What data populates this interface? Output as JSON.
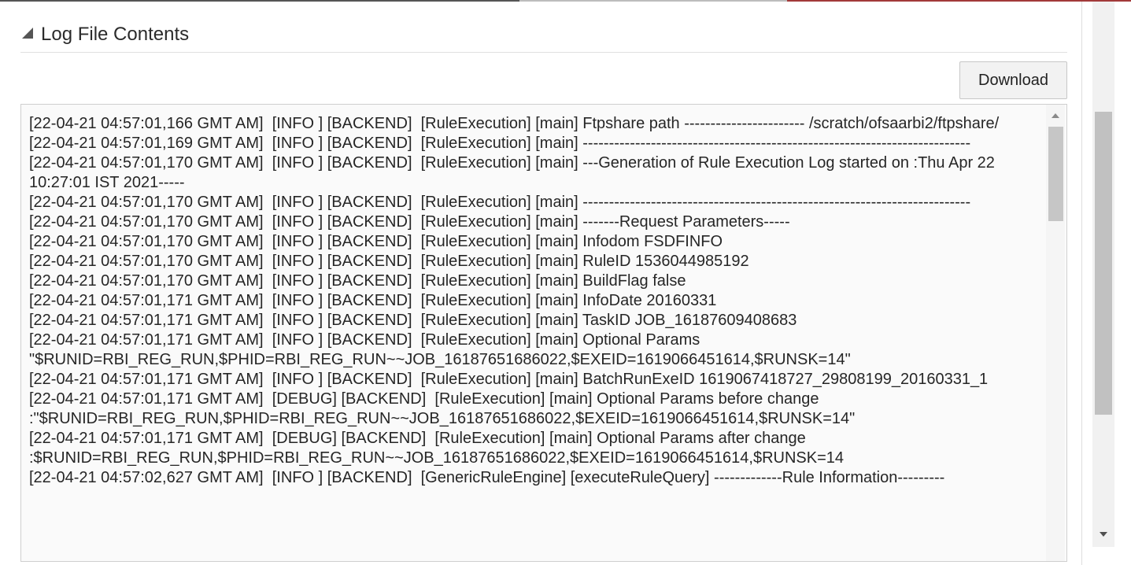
{
  "section": {
    "title": "Log File Contents",
    "collapse_icon": "triangle-collapse-icon"
  },
  "toolbar": {
    "download_label": "Download"
  },
  "log": {
    "lines": [
      "[22-04-21 04:57:01,166 GMT AM]  [INFO ] [BACKEND]  [RuleExecution] [main] Ftpshare path ----------------------- /scratch/ofsaarbi2/ftpshare/",
      "[22-04-21 04:57:01,169 GMT AM]  [INFO ] [BACKEND]  [RuleExecution] [main] --------------------------------------------------------------------------",
      "[22-04-21 04:57:01,170 GMT AM]  [INFO ] [BACKEND]  [RuleExecution] [main] ---Generation of Rule Execution Log started on :Thu Apr 22 10:27:01 IST 2021-----",
      "[22-04-21 04:57:01,170 GMT AM]  [INFO ] [BACKEND]  [RuleExecution] [main] --------------------------------------------------------------------------",
      "[22-04-21 04:57:01,170 GMT AM]  [INFO ] [BACKEND]  [RuleExecution] [main] -------Request Parameters-----",
      "[22-04-21 04:57:01,170 GMT AM]  [INFO ] [BACKEND]  [RuleExecution] [main] Infodom FSDFINFO",
      "[22-04-21 04:57:01,170 GMT AM]  [INFO ] [BACKEND]  [RuleExecution] [main] RuleID 1536044985192",
      "[22-04-21 04:57:01,170 GMT AM]  [INFO ] [BACKEND]  [RuleExecution] [main] BuildFlag false",
      "[22-04-21 04:57:01,171 GMT AM]  [INFO ] [BACKEND]  [RuleExecution] [main] InfoDate 20160331",
      "[22-04-21 04:57:01,171 GMT AM]  [INFO ] [BACKEND]  [RuleExecution] [main] TaskID JOB_16187609408683",
      "[22-04-21 04:57:01,171 GMT AM]  [INFO ] [BACKEND]  [RuleExecution] [main] Optional Params \"$RUNID=RBI_REG_RUN,$PHID=RBI_REG_RUN~~JOB_16187651686022,$EXEID=1619066451614,$RUNSK=14\"",
      "[22-04-21 04:57:01,171 GMT AM]  [INFO ] [BACKEND]  [RuleExecution] [main] BatchRunExeID 1619067418727_29808199_20160331_1",
      "[22-04-21 04:57:01,171 GMT AM]  [DEBUG] [BACKEND]  [RuleExecution] [main] Optional Params before change :\"$RUNID=RBI_REG_RUN,$PHID=RBI_REG_RUN~~JOB_16187651686022,$EXEID=1619066451614,$RUNSK=14\"",
      "[22-04-21 04:57:01,171 GMT AM]  [DEBUG] [BACKEND]  [RuleExecution] [main] Optional Params after change :$RUNID=RBI_REG_RUN,$PHID=RBI_REG_RUN~~JOB_16187651686022,$EXEID=1619066451614,$RUNSK=14",
      "[22-04-21 04:57:02,627 GMT AM]  [INFO ] [BACKEND]  [GenericRuleEngine] [executeRuleQuery] -------------Rule Information---------"
    ]
  },
  "scrollbars": {
    "inner_up_icon": "arrow-up-icon",
    "page_down_icon": "arrow-down-icon"
  }
}
